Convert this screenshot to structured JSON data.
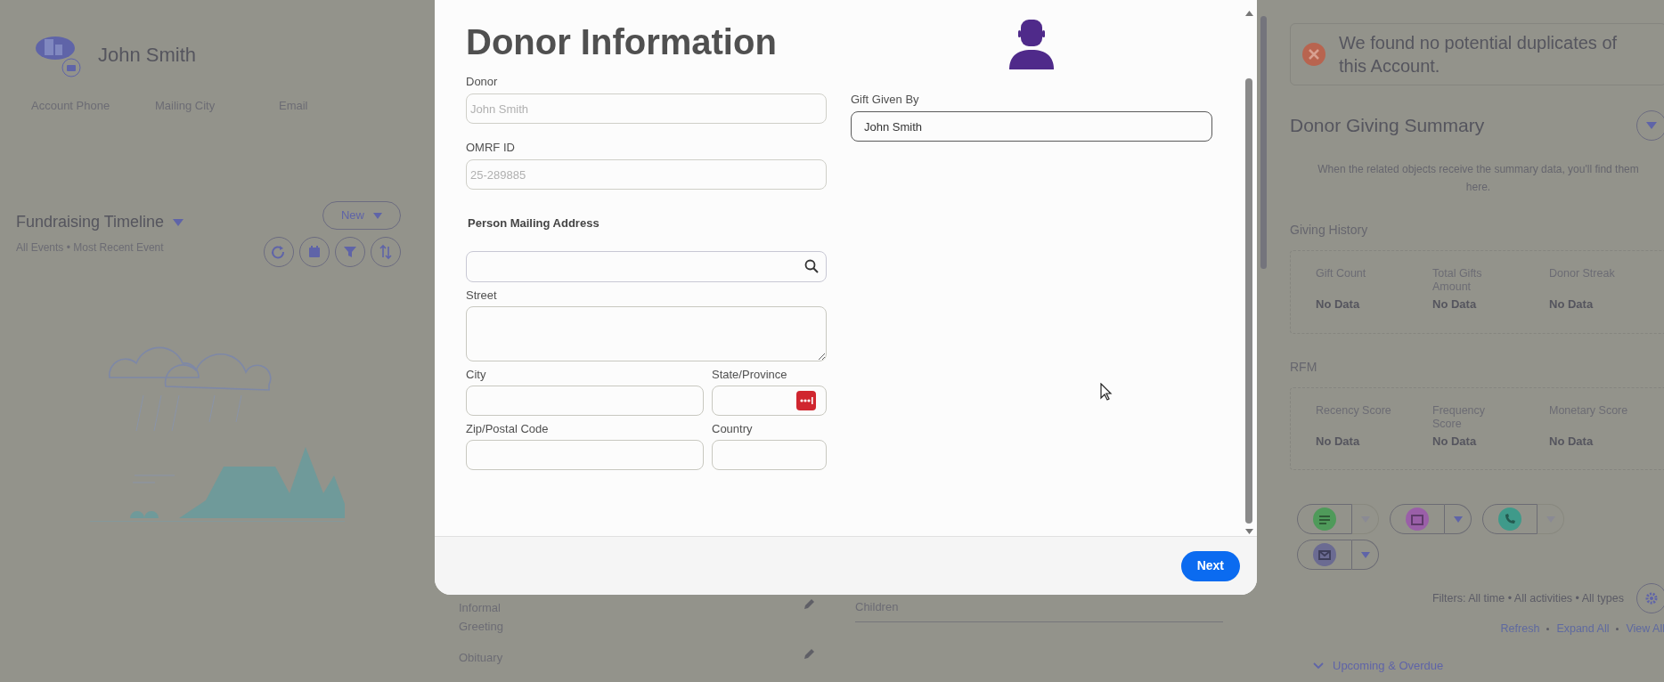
{
  "record": {
    "name": "John Smith",
    "fields": [
      "Account Phone",
      "Mailing City",
      "Email"
    ]
  },
  "timeline": {
    "title": "Fundraising Timeline",
    "subtitle": "All Events • Most Recent Event",
    "new_button": "New"
  },
  "details": {
    "fields": [
      {
        "label": "Informal Greeting"
      },
      {
        "label": "Obituary"
      }
    ],
    "related": "Children"
  },
  "modal": {
    "title": "Donor Information",
    "fields": [
      {
        "label": "Donor",
        "value": "John Smith",
        "disabled": true
      },
      {
        "label": "OMRF ID",
        "value": "25-289885",
        "disabled": true
      }
    ],
    "gift_given_by": {
      "label": "Gift Given By",
      "value": "John Smith",
      "disabled": false
    },
    "address": {
      "heading": "Person Mailing Address",
      "fields": [
        {
          "kind": "search"
        },
        {
          "kind": "textarea",
          "label": "Street"
        },
        {
          "kind": "text",
          "label": "City"
        },
        {
          "kind": "picker",
          "label": "State/Province"
        },
        {
          "kind": "text",
          "label": "Zip/Postal Code"
        },
        {
          "kind": "text",
          "label": "Country"
        }
      ]
    },
    "next_button": "Next"
  },
  "duplicates": {
    "message": "We found no potential duplicates of this Account."
  },
  "giving_summary": {
    "title": "Donor Giving Summary",
    "description": "When the related objects receive the summary data, you'll find them here.",
    "groups": [
      {
        "title": "Giving History",
        "metrics": [
          {
            "label": "Gift Count",
            "value": "No Data"
          },
          {
            "label": "Total Gifts Amount",
            "value": "No Data"
          },
          {
            "label": "Donor Streak",
            "value": "No Data"
          }
        ]
      },
      {
        "title": "RFM",
        "metrics": [
          {
            "label": "Recency Score",
            "value": "No Data"
          },
          {
            "label": "Frequency Score",
            "value": "No Data"
          },
          {
            "label": "Monetary Score",
            "value": "No Data"
          }
        ]
      }
    ]
  },
  "activity": {
    "actions": [
      {
        "kind": "task",
        "color": "#4f9a5a",
        "disabled": true
      },
      {
        "kind": "event",
        "color": "#9a5fa8",
        "disabled": false
      },
      {
        "kind": "call",
        "color": "#3f9a8a",
        "disabled": true
      },
      {
        "kind": "email",
        "color": "#6b6b92",
        "disabled": false
      }
    ],
    "filters": "Filters: All time • All activities • All types",
    "links": [
      "Refresh",
      "Expand All",
      "View All"
    ],
    "section": "Upcoming & Overdue"
  }
}
